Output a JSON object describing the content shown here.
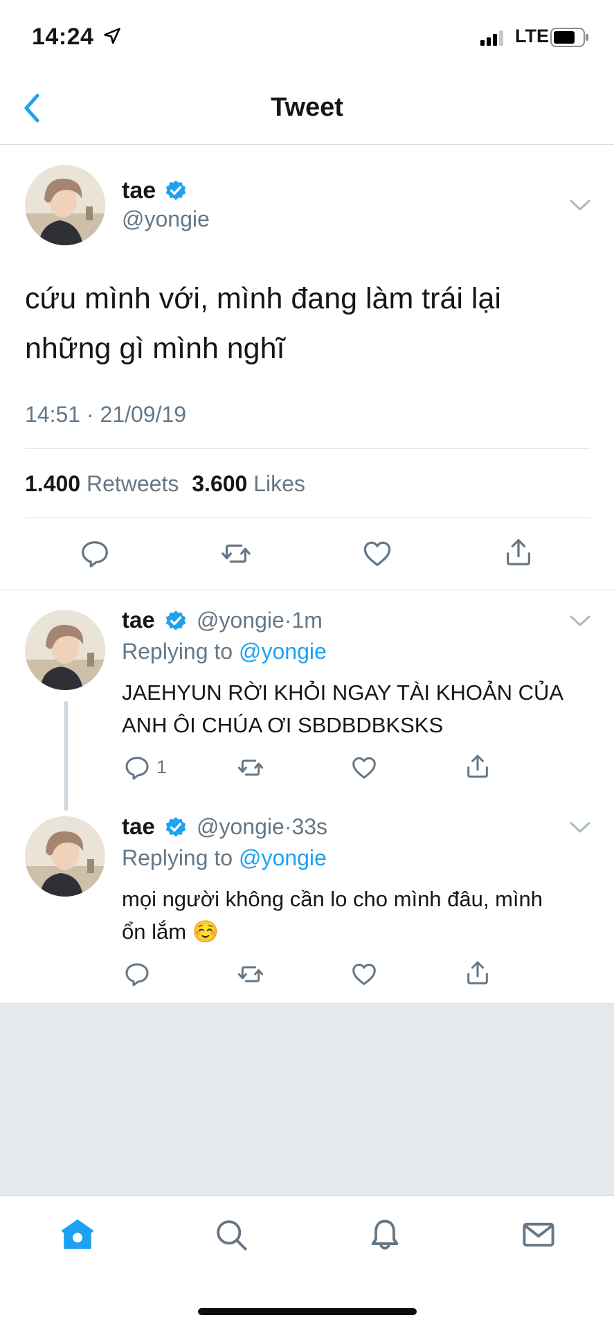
{
  "status_bar": {
    "time": "14:24",
    "network": "LTE"
  },
  "nav": {
    "title": "Tweet"
  },
  "tweet": {
    "name": "tae",
    "handle": "@yongie",
    "text": "cứu mình với, mình đang làm trái lại những gì mình nghĩ",
    "timestamp": "14:51 · 21/09/19",
    "retweets_count": "1.400",
    "retweets_label": "Retweets",
    "likes_count": "3.600",
    "likes_label": "Likes"
  },
  "replies": [
    {
      "name": "tae",
      "handle": "@yongie",
      "sep": "·",
      "time": "1m",
      "replying_label": "Replying to",
      "replying_handle": "@yongie",
      "text": "JAEHYUN RỜI KHỎI NGAY TÀI KHOẢN CỦA ANH ÔI CHÚA ƠI SBDBDBKSKS",
      "reply_count": "1"
    },
    {
      "name": "tae",
      "handle": "@yongie",
      "sep": "·",
      "time": "33s",
      "replying_label": "Replying to",
      "replying_handle": "@yongie",
      "text": "mọi người không cần lo cho mình đâu, mình ổn lắm ☺️",
      "reply_count": ""
    }
  ],
  "tabs": [
    "home-icon",
    "search-icon",
    "bell-icon",
    "mail-icon"
  ],
  "colors": {
    "accent": "#1da1f2",
    "text": "#14171a",
    "secondary": "#657786",
    "divider": "#e1e8ed",
    "empty_area": "#e6e9ee"
  }
}
